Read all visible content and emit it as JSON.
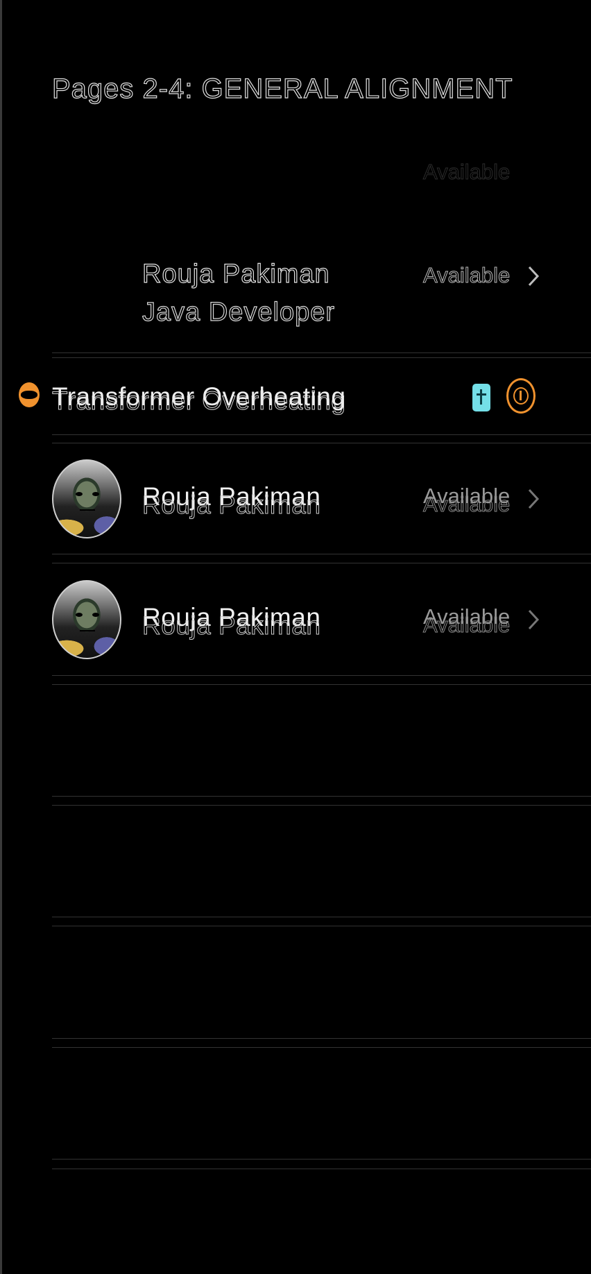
{
  "header": {
    "title": "Pages 2-4: GENERAL ALIGNMENT"
  },
  "rows": {
    "ghost": {
      "status": "Available"
    },
    "outline": {
      "name": "Rouja Pakiman",
      "subtitle": "Java Developer",
      "status": "Available"
    },
    "alert": {
      "title": "Transformer Overheating",
      "dot_color": "#f0922e",
      "phone_icon": "phone-icon",
      "target_icon": "target-icon"
    },
    "contact_1": {
      "name": "Rouja Pakiman",
      "status": "Available",
      "avatar": "avatar-image"
    },
    "contact_2": {
      "name": "Rouja Pakiman",
      "status": "Available",
      "avatar": "avatar-image"
    }
  },
  "colors": {
    "background": "#000000",
    "accent_orange": "#f0922e",
    "accent_cyan": "#74dfe8",
    "separator": "#333333"
  }
}
